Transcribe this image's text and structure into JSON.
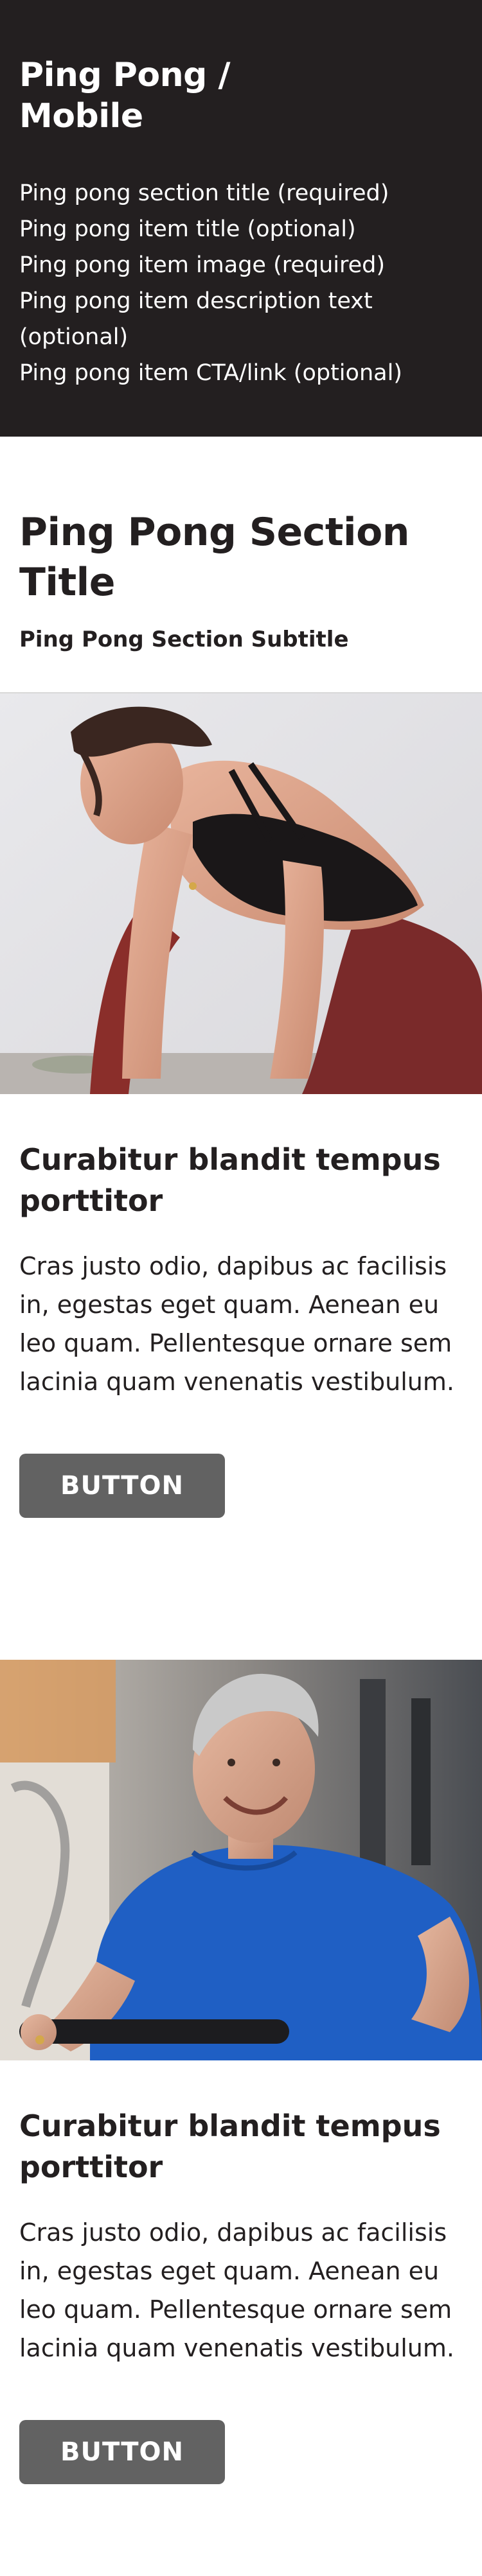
{
  "info": {
    "title_line1": "Ping Pong /",
    "title_line2": "Mobile",
    "items": [
      "Ping pong section title (required)",
      "Ping pong item title (optional)",
      "Ping pong item image (required)",
      "Ping pong item description text (optional)",
      "Ping pong item CTA/link (optional)"
    ]
  },
  "section": {
    "title": "Ping Pong Section Title",
    "subtitle": "Ping Pong Section Subtitle"
  },
  "items": [
    {
      "image_name": "woman-workout-image",
      "title": "Curabitur blandit tempus porttitor",
      "description": "Cras justo odio, dapibus ac facilisis in, egestas eget quam. Aenean eu leo quam. Pellentesque ornare sem lacinia quam venenatis vestibulum.",
      "button": "BUTTON"
    },
    {
      "image_name": "man-rowing-image",
      "title": "Curabitur blandit tempus porttitor",
      "description": "Cras justo odio, dapibus ac facilisis in, egestas eget quam. Aenean eu leo quam. Pellentesque ornare sem lacinia quam venenatis vestibulum.",
      "button": "BUTTON"
    }
  ],
  "colors": {
    "header_bg": "#231f20",
    "text": "#231f20",
    "button_bg": "#626262",
    "button_text": "#ffffff"
  }
}
